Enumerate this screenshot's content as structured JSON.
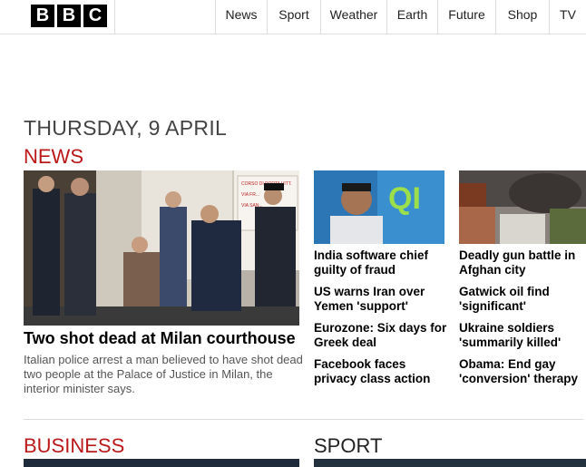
{
  "logo": {
    "letters": [
      "B",
      "B",
      "C"
    ]
  },
  "nav": {
    "items": [
      {
        "label": "News"
      },
      {
        "label": "Sport"
      },
      {
        "label": "Weather"
      },
      {
        "label": "Earth"
      },
      {
        "label": "Future"
      },
      {
        "label": "Shop"
      },
      {
        "label": "TV"
      }
    ]
  },
  "date": "THURSDAY, 9 APRIL",
  "sections": {
    "news": "NEWS",
    "business": "BUSINESS",
    "sport": "SPORT"
  },
  "lead": {
    "headline": "Two shot dead at Milan courthouse",
    "summary": "Italian police arrest a man believed to have shot dead two people at the Palace of Justice in Milan, the interior minister says.",
    "image_sign": [
      "CORSO DI PORTA VITT.",
      "VIA FR...",
      "VIA SAN..."
    ]
  },
  "thumbs": {
    "india_logo": "QI"
  },
  "stories": {
    "col1": [
      "India software chief guilty of fraud",
      "US warns Iran over Yemen 'support'",
      "Eurozone: Six days for Greek deal",
      "Facebook faces privacy class action"
    ],
    "col2": [
      "Deadly gun battle in Afghan city",
      "Gatwick oil find 'significant'",
      "Ukraine soldiers 'summarily killed'",
      "Obama: End gay 'conversion' therapy"
    ]
  },
  "colors": {
    "section_red": "#bb1919",
    "logo_black": "#000000"
  }
}
